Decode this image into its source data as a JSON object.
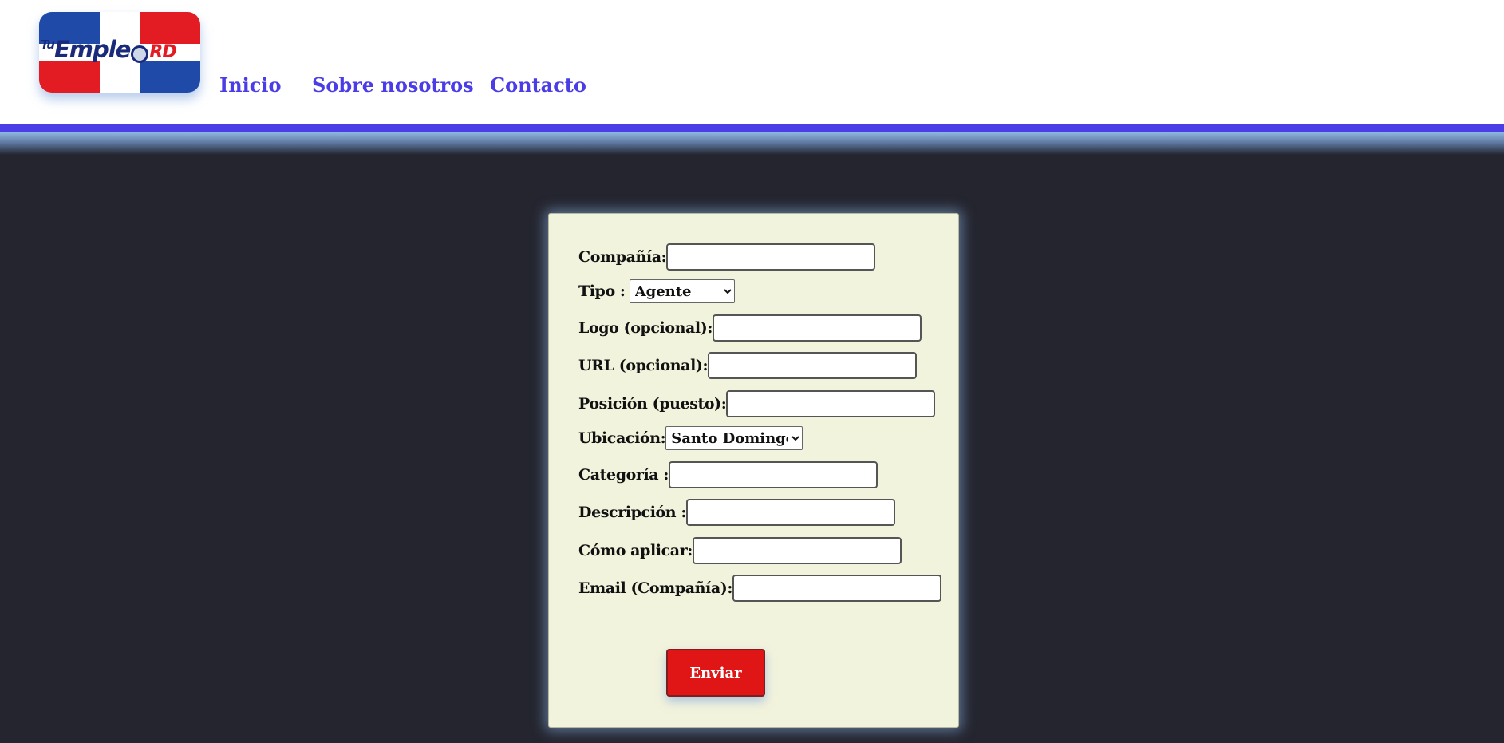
{
  "logo": {
    "tu": "Tu",
    "emple": "Emple",
    "rd": "RD"
  },
  "nav": {
    "items": [
      "Inicio",
      "Sobre nosotros",
      "Contacto"
    ]
  },
  "form": {
    "fields": [
      {
        "label": "Compañía:",
        "value": ""
      },
      {
        "label": "Tipo :",
        "selected": "Agente"
      },
      {
        "label": "Logo (opcional):",
        "value": ""
      },
      {
        "label": "URL (opcional):",
        "value": ""
      },
      {
        "label": "Posición (puesto):",
        "value": ""
      },
      {
        "label": "Ubicación:",
        "selected": "Santo Domingo"
      },
      {
        "label": "Categoría :",
        "value": ""
      },
      {
        "label": "Descripción :",
        "value": ""
      },
      {
        "label": "Cómo aplicar:",
        "value": ""
      },
      {
        "label": "Email (Compañía):",
        "value": ""
      }
    ],
    "submit_label": "Enviar"
  },
  "colors": {
    "accent": "#4b3ee6",
    "submit": "#e01515",
    "card": "#f2f3dc",
    "background": "#24252f"
  }
}
